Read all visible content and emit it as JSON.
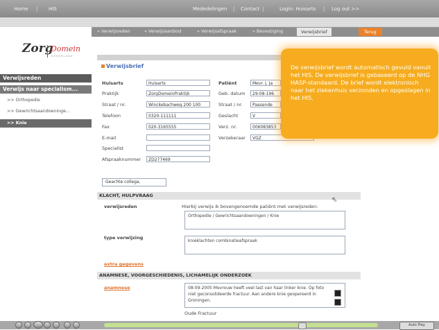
{
  "topbar": {
    "home": "Home",
    "his": "HIS",
    "mededelingen": "Mededelingen",
    "contact": "Contact",
    "login": "Login: Huisarts",
    "logout": "Log out >>"
  },
  "tabs": {
    "t1": "« Verwijsreden",
    "t2": "« Verwijsaanbod",
    "t3": "« Verwijsafspraak",
    "t4": "» Bevestiging",
    "t5": "Verwijsbrief",
    "t6": "Terug"
  },
  "logo": {
    "zorg": "Zorg",
    "domein": "Domein",
    "ned": "NEDERLAND"
  },
  "sidebar": {
    "head1": "Verwijsreden",
    "head2": "Verwijs naar specialism...",
    "items": [
      ">> Orthopedie",
      ">> Gewrichtsaandoeninge...",
      ">> Knie"
    ]
  },
  "form": {
    "title": "Verwijsbrief",
    "huisarts_label": "Huisarts",
    "huisarts_value": "Huisarts",
    "praktijk_label": "Praktijk",
    "praktijk_value": "ZorgDomeinPraktijk",
    "straat_label": "Straat / nr.",
    "straat_value": "Winckebachweg 200 100",
    "telefoon_label": "Telefoon",
    "telefoon_value": "0320-111111",
    "fax_label": "Fax",
    "fax_value": "020-3165555",
    "email_label": "E-mail",
    "specialist_label": "Specialist",
    "afspraak_label": "Afspraaknummer",
    "afspraak_value": "ZD277469",
    "patient_label": "Patiënt",
    "patient_value": "Mevr. J. Ja",
    "geb_label": "Geb. datum",
    "geb_value": "29-08-196",
    "pstraat_label": "Straat / nr.",
    "pstraat_value": "Paasende",
    "geslacht_label": "Geslacht",
    "geslacht_value": "V",
    "verz_label": "Verz. nr.",
    "verz_value": "006083853",
    "verzekeraar_label": "Verzekeraar",
    "verzekeraar_value": "VGZ",
    "collega": "Geachte collega,"
  },
  "klacht": {
    "header": "KLACHT, HULPVRAAG",
    "verwijsreden_label": "verwijsreden",
    "intro": "Hierbij verwijs ik bovengenoemde patiënt met verwijsreden:",
    "verwijsreden_value": "Orthopedie / Gewrichtsaandoeningen / Knie",
    "type_label": "type verwijzing",
    "type_value": "knieklachten combinatieafspraak",
    "extra": "extra gegevens"
  },
  "anamnese": {
    "header": "ANAMNESE, VOORGESCHIEDENIS, LICHAMELIJK ONDERZOEK",
    "label": "anamnese",
    "text": "08-09-2005 Mevrouw heeft veel last van haar linker knie. Op foto niet geconsolideerde fractuur. Aan andere knie geopereerd in Groningen.",
    "oude": "Oude Fractuur"
  },
  "tooltip": {
    "text": "De verwijsbrief wordt automatisch gevuld vanuit het HIS. De verwijsbrief is gebaseerd op de NHG HASP-standaard. De brief wordt elektronisch naar het ziekenhuis verzonden en opgeslagen in het HIS."
  },
  "player": {
    "right_btn": "Auto Play"
  }
}
